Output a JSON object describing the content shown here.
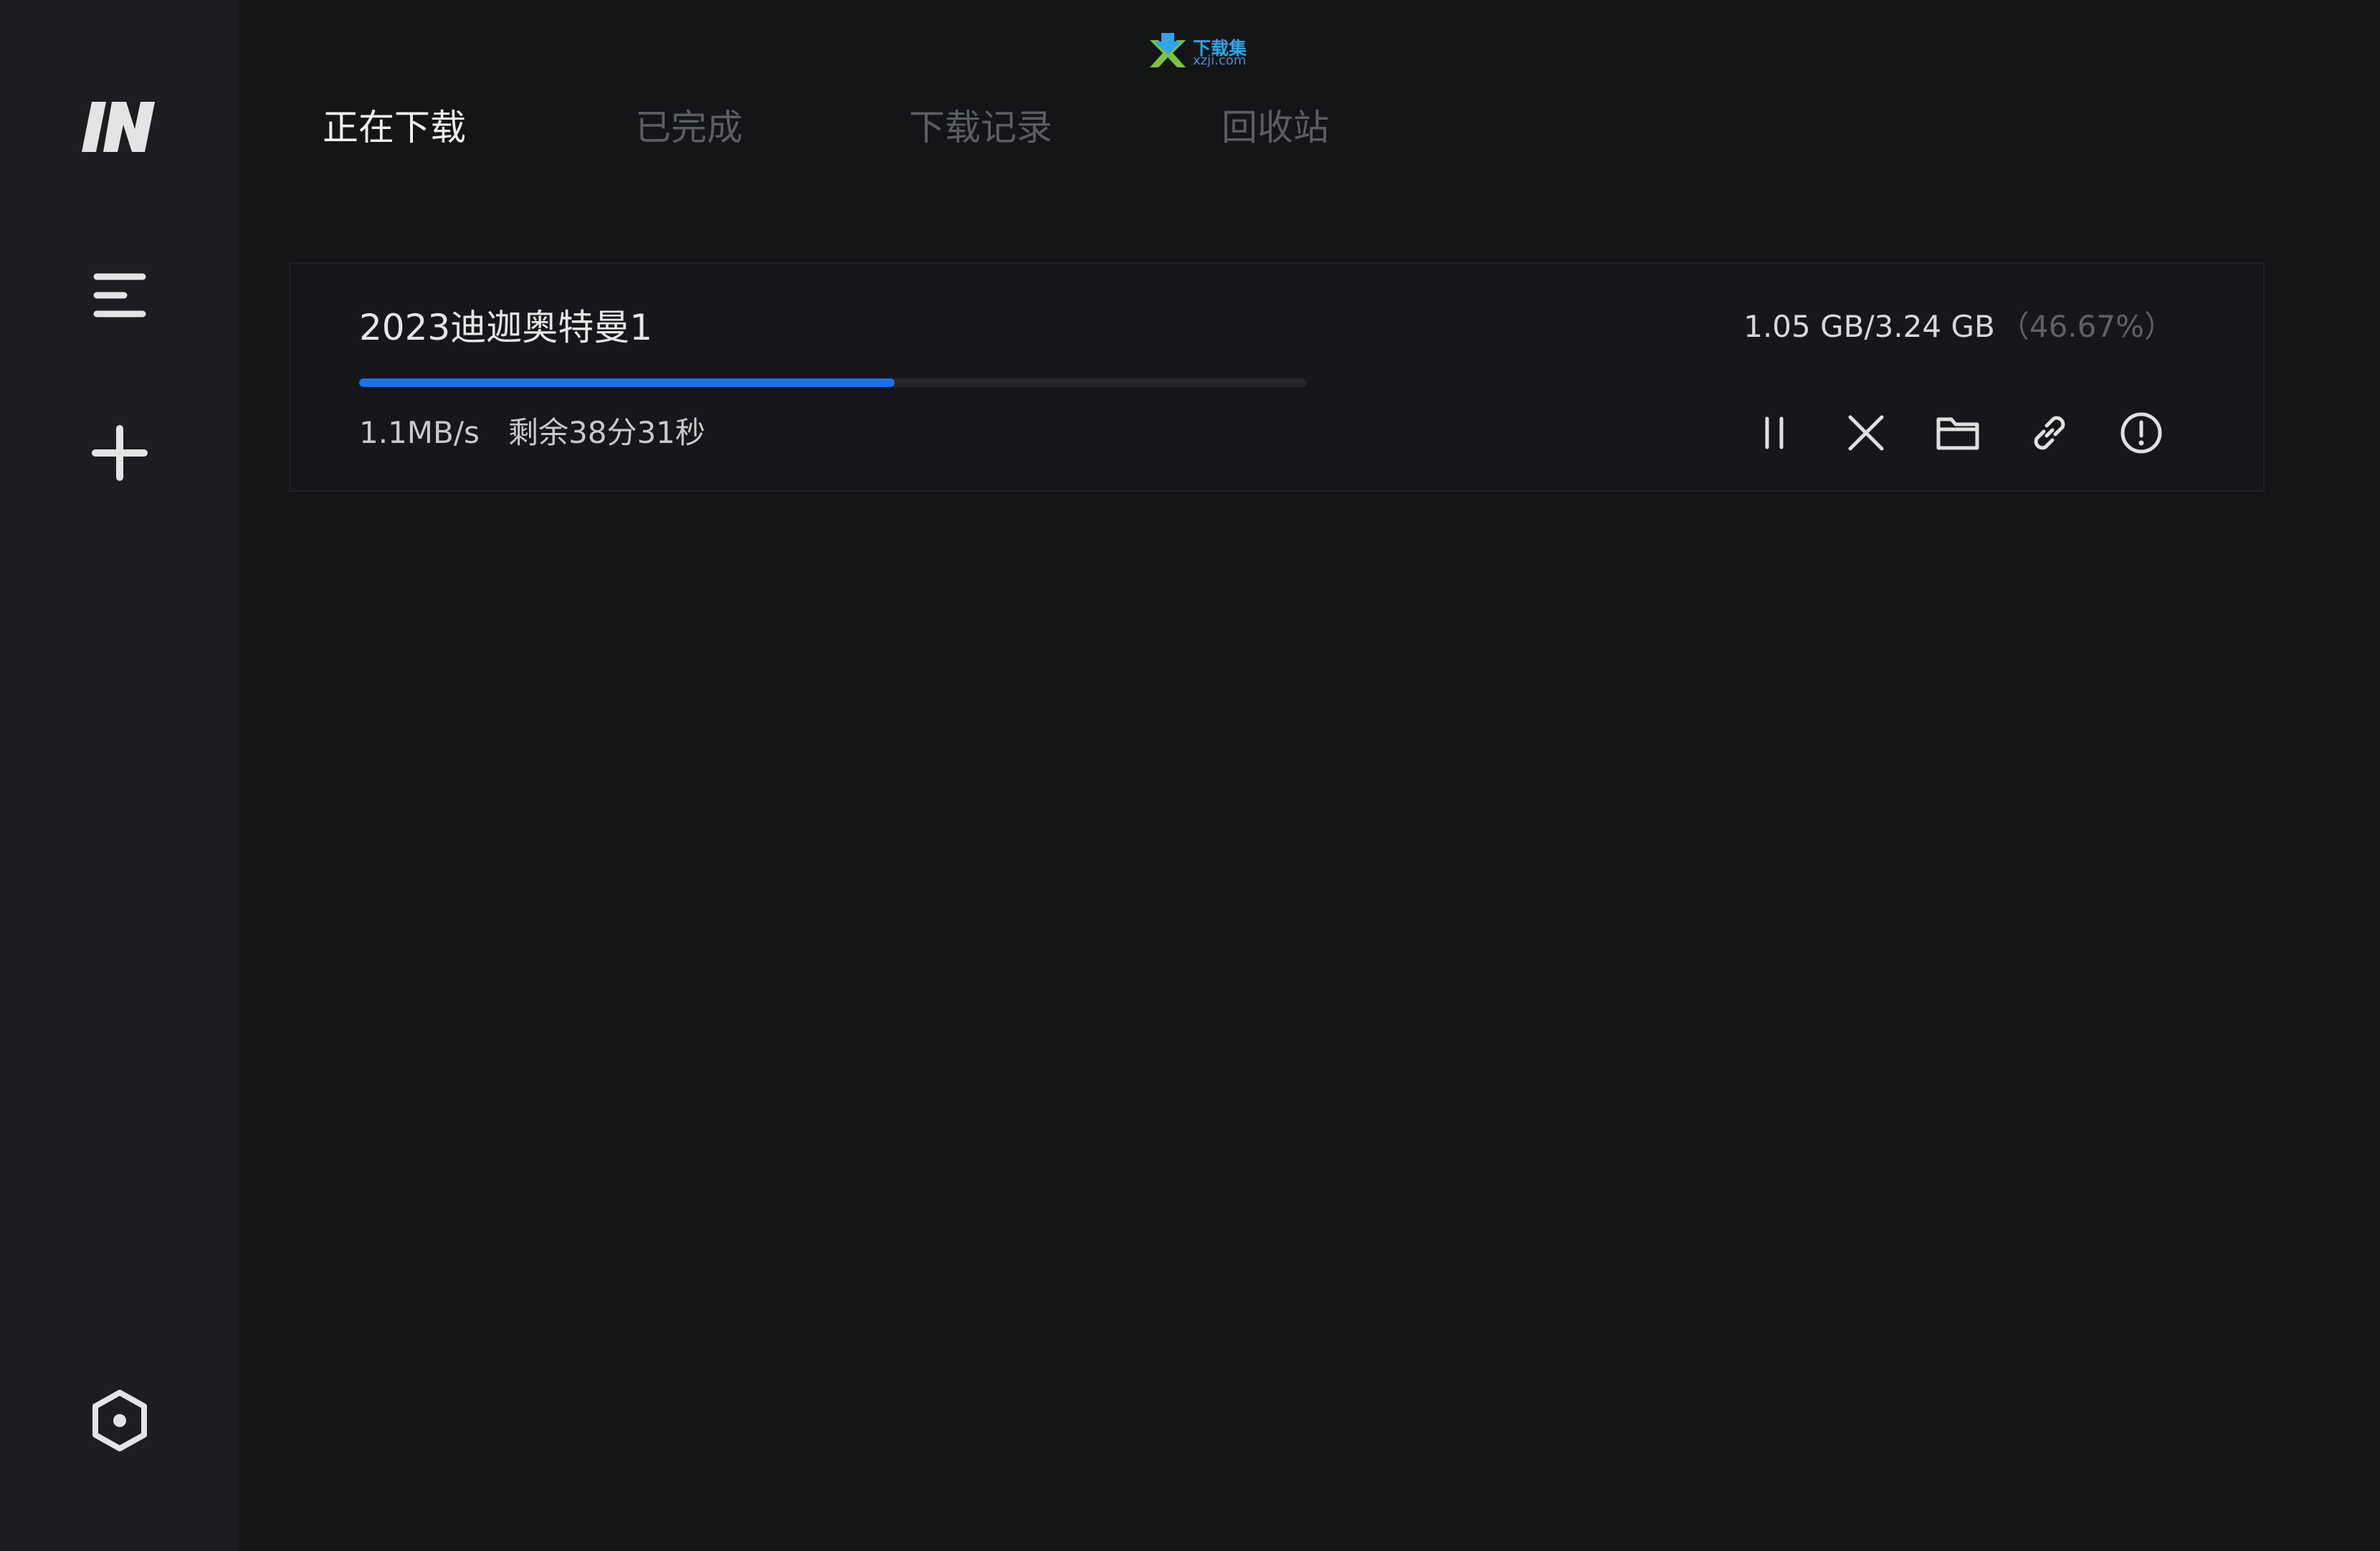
{
  "app": {
    "logo_icon": "in-logo-icon"
  },
  "watermark": {
    "line1": "下载集",
    "line2": "xzji.com"
  },
  "sidebar": {
    "items": [
      {
        "icon": "menu-icon"
      },
      {
        "icon": "plus-icon"
      },
      {
        "icon": "settings-hexagon-icon"
      }
    ]
  },
  "tabs": [
    {
      "label": "正在下载",
      "active": true
    },
    {
      "label": "已完成",
      "active": false
    },
    {
      "label": "下载记录",
      "active": false
    },
    {
      "label": "回收站",
      "active": false
    }
  ],
  "download": {
    "name": "2023迪迦奥特曼1",
    "size": "1.05 GB/3.24 GB",
    "percent_label": "（46.67%）",
    "progress": 0.4667,
    "speed": "1.1MB/s",
    "remaining": "剩余38分31秒",
    "actions": [
      {
        "icon": "pause-icon"
      },
      {
        "icon": "close-icon"
      },
      {
        "icon": "folder-icon"
      },
      {
        "icon": "link-icon"
      },
      {
        "icon": "info-icon"
      }
    ]
  },
  "colors": {
    "background": "#141517",
    "sidebar": "#1c1d20",
    "accent": "#1a71f0",
    "active_tab": "#eeeeee",
    "inactive_tab": "#5b5d62"
  }
}
